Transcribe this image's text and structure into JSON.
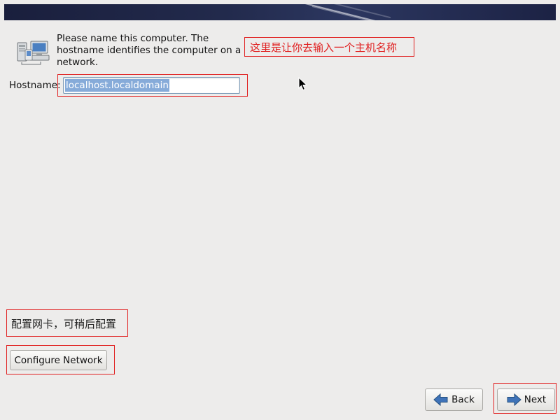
{
  "header": {
    "banner_color": "#1c2244"
  },
  "intro": {
    "icon": "network-computers-icon",
    "line1": "Please name this computer.  The",
    "line2": "hostname identifies the computer on a",
    "line3": "network."
  },
  "annotations": {
    "hostname_note": "这里是让你去输入一个主机名称",
    "network_note": "配置网卡，可稍后配置",
    "color": "#e02020"
  },
  "hostname": {
    "label": "Hostname:",
    "value": "localhost.localdomain"
  },
  "buttons": {
    "configure_network": "Configure Network",
    "back": "Back",
    "next": "Next"
  },
  "icons": {
    "back": "left-arrow-icon",
    "next": "right-arrow-icon",
    "cursor": "mouse-pointer-icon"
  }
}
